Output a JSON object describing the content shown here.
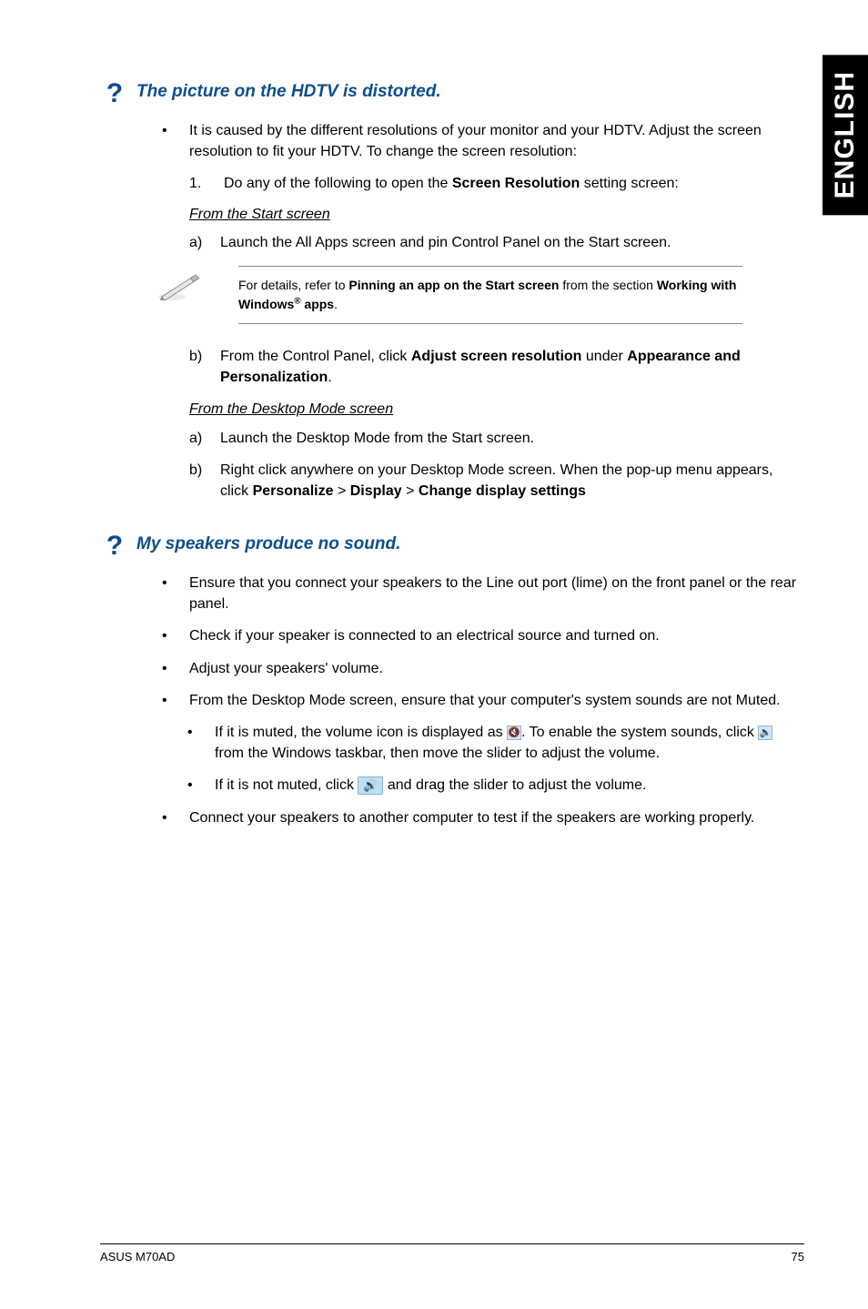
{
  "side_tab": "ENGLISH",
  "q1": {
    "title": "The picture on the HDTV is distorted.",
    "b1": "It is caused by the different resolutions of your monitor and your HDTV. Adjust the screen resolution to fit your HDTV. To change the screen resolution:",
    "n1_pre": "Do any of the following to open the ",
    "n1_bold": "Screen Resolution",
    "n1_post": " setting screen:",
    "fss": "From the Start screen",
    "a": "Launch the All Apps screen and pin Control Panel on the Start screen.",
    "note_pre": "For details, refer to ",
    "note_b1": "Pinning an app on the Start screen",
    "note_mid": " from the section ",
    "note_b2_a": "Working with Windows",
    "note_b2_b": " apps",
    "note_post": ".",
    "b_pre": "From the Control Panel, click ",
    "b_bold": "Adjust screen resolution",
    "b_mid": " under ",
    "b_bold2": "Appearance and Personalization",
    "b_post": ".",
    "fdms": "From the Desktop Mode screen",
    "da": "Launch the Desktop Mode from the Start screen.",
    "db_pre": "Right click anywhere on your Desktop Mode screen. When the pop-up menu appears, click ",
    "db_b1": "Personalize",
    "db_g1": " > ",
    "db_b2": "Display",
    "db_g2": " > ",
    "db_b3": "Change display settings"
  },
  "q2": {
    "title": "My speakers produce no sound.",
    "b1": "Ensure that you connect your speakers to the Line out port (lime) on the front panel or the rear panel.",
    "b2": "Check if your speaker is connected to an electrical source and turned on.",
    "b3": "Adjust your speakers' volume.",
    "b4": "From the Desktop Mode screen, ensure that your computer's system sounds are not Muted.",
    "i1_a": "If it is muted, the volume icon is displayed as ",
    "i1_b": ". To enable the system sounds, click ",
    "i1_c": " from the Windows taskbar, then move the slider to adjust the volume.",
    "i2_a": "If it is not muted, click ",
    "i2_b": " and drag the slider to adjust the volume.",
    "b5": "Connect your speakers to another computer to test if the speakers are working properly."
  },
  "footer_left": "ASUS M70AD",
  "footer_right": "75",
  "icons": {
    "muted": "🔇",
    "muted2": "🔈",
    "unmuted": "🔊"
  }
}
